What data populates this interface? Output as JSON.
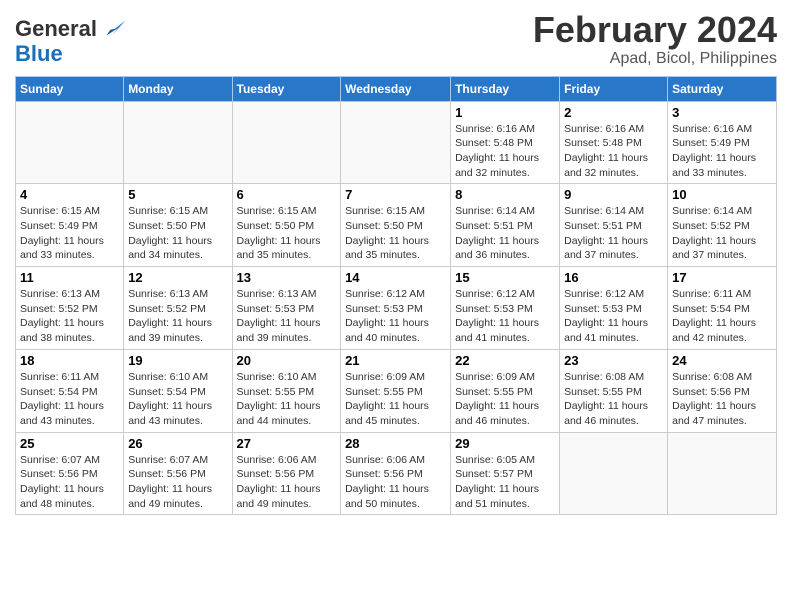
{
  "header": {
    "logo_general": "General",
    "logo_blue": "Blue",
    "month_title": "February 2024",
    "location": "Apad, Bicol, Philippines"
  },
  "days_of_week": [
    "Sunday",
    "Monday",
    "Tuesday",
    "Wednesday",
    "Thursday",
    "Friday",
    "Saturday"
  ],
  "weeks": [
    [
      {
        "day": "",
        "info": ""
      },
      {
        "day": "",
        "info": ""
      },
      {
        "day": "",
        "info": ""
      },
      {
        "day": "",
        "info": ""
      },
      {
        "day": "1",
        "info": "Sunrise: 6:16 AM\nSunset: 5:48 PM\nDaylight: 11 hours and 32 minutes."
      },
      {
        "day": "2",
        "info": "Sunrise: 6:16 AM\nSunset: 5:48 PM\nDaylight: 11 hours and 32 minutes."
      },
      {
        "day": "3",
        "info": "Sunrise: 6:16 AM\nSunset: 5:49 PM\nDaylight: 11 hours and 33 minutes."
      }
    ],
    [
      {
        "day": "4",
        "info": "Sunrise: 6:15 AM\nSunset: 5:49 PM\nDaylight: 11 hours and 33 minutes."
      },
      {
        "day": "5",
        "info": "Sunrise: 6:15 AM\nSunset: 5:50 PM\nDaylight: 11 hours and 34 minutes."
      },
      {
        "day": "6",
        "info": "Sunrise: 6:15 AM\nSunset: 5:50 PM\nDaylight: 11 hours and 35 minutes."
      },
      {
        "day": "7",
        "info": "Sunrise: 6:15 AM\nSunset: 5:50 PM\nDaylight: 11 hours and 35 minutes."
      },
      {
        "day": "8",
        "info": "Sunrise: 6:14 AM\nSunset: 5:51 PM\nDaylight: 11 hours and 36 minutes."
      },
      {
        "day": "9",
        "info": "Sunrise: 6:14 AM\nSunset: 5:51 PM\nDaylight: 11 hours and 37 minutes."
      },
      {
        "day": "10",
        "info": "Sunrise: 6:14 AM\nSunset: 5:52 PM\nDaylight: 11 hours and 37 minutes."
      }
    ],
    [
      {
        "day": "11",
        "info": "Sunrise: 6:13 AM\nSunset: 5:52 PM\nDaylight: 11 hours and 38 minutes."
      },
      {
        "day": "12",
        "info": "Sunrise: 6:13 AM\nSunset: 5:52 PM\nDaylight: 11 hours and 39 minutes."
      },
      {
        "day": "13",
        "info": "Sunrise: 6:13 AM\nSunset: 5:53 PM\nDaylight: 11 hours and 39 minutes."
      },
      {
        "day": "14",
        "info": "Sunrise: 6:12 AM\nSunset: 5:53 PM\nDaylight: 11 hours and 40 minutes."
      },
      {
        "day": "15",
        "info": "Sunrise: 6:12 AM\nSunset: 5:53 PM\nDaylight: 11 hours and 41 minutes."
      },
      {
        "day": "16",
        "info": "Sunrise: 6:12 AM\nSunset: 5:53 PM\nDaylight: 11 hours and 41 minutes."
      },
      {
        "day": "17",
        "info": "Sunrise: 6:11 AM\nSunset: 5:54 PM\nDaylight: 11 hours and 42 minutes."
      }
    ],
    [
      {
        "day": "18",
        "info": "Sunrise: 6:11 AM\nSunset: 5:54 PM\nDaylight: 11 hours and 43 minutes."
      },
      {
        "day": "19",
        "info": "Sunrise: 6:10 AM\nSunset: 5:54 PM\nDaylight: 11 hours and 43 minutes."
      },
      {
        "day": "20",
        "info": "Sunrise: 6:10 AM\nSunset: 5:55 PM\nDaylight: 11 hours and 44 minutes."
      },
      {
        "day": "21",
        "info": "Sunrise: 6:09 AM\nSunset: 5:55 PM\nDaylight: 11 hours and 45 minutes."
      },
      {
        "day": "22",
        "info": "Sunrise: 6:09 AM\nSunset: 5:55 PM\nDaylight: 11 hours and 46 minutes."
      },
      {
        "day": "23",
        "info": "Sunrise: 6:08 AM\nSunset: 5:55 PM\nDaylight: 11 hours and 46 minutes."
      },
      {
        "day": "24",
        "info": "Sunrise: 6:08 AM\nSunset: 5:56 PM\nDaylight: 11 hours and 47 minutes."
      }
    ],
    [
      {
        "day": "25",
        "info": "Sunrise: 6:07 AM\nSunset: 5:56 PM\nDaylight: 11 hours and 48 minutes."
      },
      {
        "day": "26",
        "info": "Sunrise: 6:07 AM\nSunset: 5:56 PM\nDaylight: 11 hours and 49 minutes."
      },
      {
        "day": "27",
        "info": "Sunrise: 6:06 AM\nSunset: 5:56 PM\nDaylight: 11 hours and 49 minutes."
      },
      {
        "day": "28",
        "info": "Sunrise: 6:06 AM\nSunset: 5:56 PM\nDaylight: 11 hours and 50 minutes."
      },
      {
        "day": "29",
        "info": "Sunrise: 6:05 AM\nSunset: 5:57 PM\nDaylight: 11 hours and 51 minutes."
      },
      {
        "day": "",
        "info": ""
      },
      {
        "day": "",
        "info": ""
      }
    ]
  ]
}
